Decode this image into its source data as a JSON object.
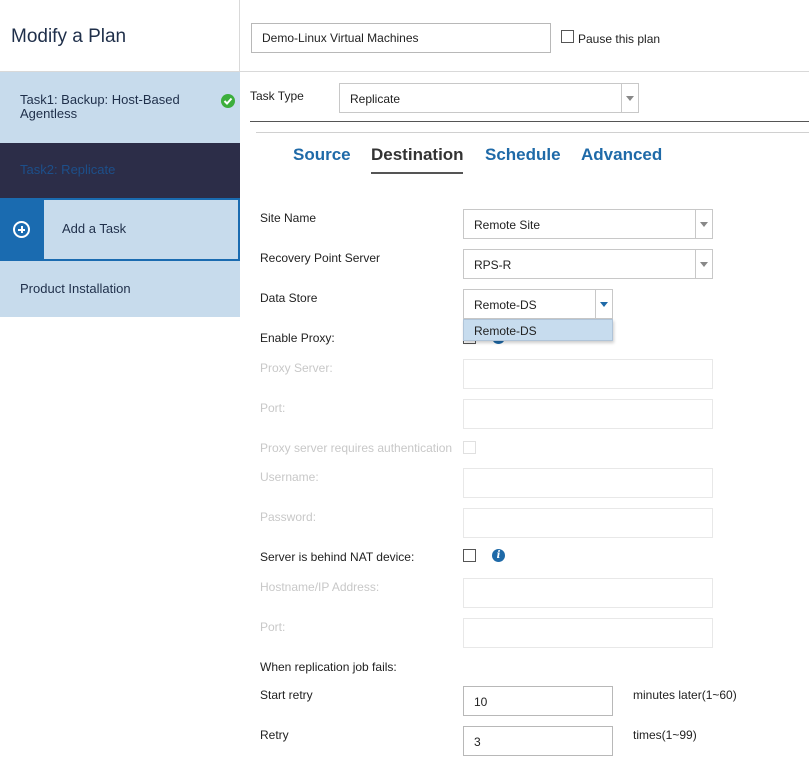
{
  "header": {
    "title": "Modify a Plan",
    "plan_name": "Demo-Linux Virtual Machines",
    "pause_label": "Pause this plan",
    "pause_checked": false
  },
  "sidebar": {
    "items": [
      {
        "label": "Task1: Backup: Host-Based Agentless",
        "status": "completed"
      },
      {
        "label": "Task2: Replicate",
        "selected": true
      },
      {
        "label": "Add a Task"
      },
      {
        "label": "Product Installation"
      }
    ]
  },
  "task_type": {
    "label": "Task Type",
    "value": "Replicate"
  },
  "tabs": [
    {
      "label": "Source"
    },
    {
      "label": "Destination",
      "active": true
    },
    {
      "label": "Schedule"
    },
    {
      "label": "Advanced"
    }
  ],
  "form": {
    "site_name_label": "Site Name",
    "site_name_value": "Remote Site",
    "rps_label": "Recovery Point Server",
    "rps_value": "RPS-R",
    "data_store_label": "Data Store",
    "data_store_value": "Remote-DS",
    "data_store_options": [
      "Remote-DS"
    ],
    "enable_proxy_label": "Enable Proxy:",
    "proxy_server_label": "Proxy Server:",
    "proxy_port_label": "Port:",
    "proxy_auth_label": "Proxy server requires authentication",
    "username_label": "Username:",
    "password_label": "Password:",
    "nat_label": "Server is behind NAT device:",
    "hostname_label": "Hostname/IP Address:",
    "nat_port_label": "Port:",
    "fail_label": "When replication job fails:",
    "start_retry_label": "Start retry",
    "start_retry_value": "10",
    "start_retry_unit": "minutes later(1~60)",
    "retry_label": "Retry",
    "retry_value": "3",
    "retry_unit": "times(1~99)"
  },
  "colors": {
    "accent": "#1f6aa8",
    "sidebar_bg": "#c7dbec",
    "selected_bg": "#2c2d48",
    "success": "#3cae3c"
  }
}
